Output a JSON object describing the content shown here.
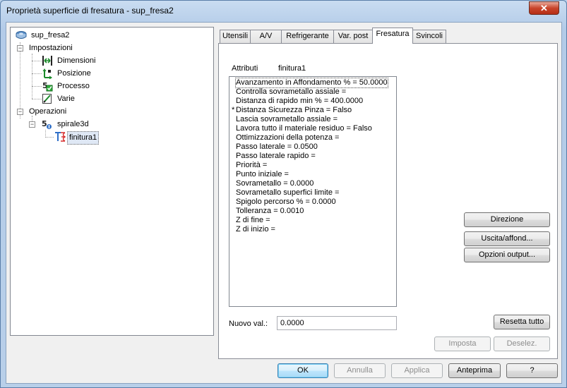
{
  "window": {
    "title": "Proprietà superficie di fresatura - sup_fresa2",
    "close_glyph": "✕"
  },
  "tree": {
    "root": {
      "label": "sup_fresa2",
      "icon": "surface-icon"
    },
    "impostazioni": {
      "label": "Impostazioni"
    },
    "items": [
      {
        "label": "Dimensioni",
        "icon": "dimensions-icon"
      },
      {
        "label": "Posizione",
        "icon": "position-icon"
      },
      {
        "label": "Processo",
        "icon": "process-icon"
      },
      {
        "label": "Varie",
        "icon": "misc-icon"
      }
    ],
    "operazioni": {
      "label": "Operazioni"
    },
    "spirale": {
      "label": "spirale3d",
      "icon": "operation-icon"
    },
    "finitura": {
      "label": "finitura1",
      "icon": "finishing-icon"
    }
  },
  "tabs": [
    {
      "label": "Utensili"
    },
    {
      "label": "A/V"
    },
    {
      "label": "Refrigerante"
    },
    {
      "label": "Var. post"
    },
    {
      "label": "Fresatura",
      "active": true
    },
    {
      "label": "Svincoli"
    }
  ],
  "attributes": {
    "label": "Attributi",
    "value": "finitura1"
  },
  "list": [
    {
      "mark": "",
      "text": "Avanzamento in Affondamento % = 50.0000"
    },
    {
      "mark": "",
      "text": "Controlla sovrametallo assiale ="
    },
    {
      "mark": "",
      "text": "Distanza di rapido min % = 400.0000"
    },
    {
      "mark": "*",
      "text": "Distanza Sicurezza Pinza = Falso"
    },
    {
      "mark": "",
      "text": "Lascia sovrametallo assiale ="
    },
    {
      "mark": "",
      "text": "Lavora tutto il materiale residuo = Falso"
    },
    {
      "mark": "",
      "text": "Ottimizzazioni della potenza ="
    },
    {
      "mark": "",
      "text": "Passo laterale = 0.0500"
    },
    {
      "mark": "",
      "text": "Passo laterale rapido ="
    },
    {
      "mark": "",
      "text": "Priorità ="
    },
    {
      "mark": "",
      "text": "Punto iniziale ="
    },
    {
      "mark": "",
      "text": "Sovrametallo = 0.0000"
    },
    {
      "mark": "",
      "text": "Sovrametallo superfici limite ="
    },
    {
      "mark": "",
      "text": "Spigolo percorso % = 0.0000"
    },
    {
      "mark": "",
      "text": "Tolleranza = 0.0010"
    },
    {
      "mark": "",
      "text": "Z di fine ="
    },
    {
      "mark": "",
      "text": "Z di inizio ="
    }
  ],
  "new_value": {
    "label": "Nuovo val.:",
    "value": "0.0000"
  },
  "side_buttons": {
    "direzione": "Direzione",
    "uscita": "Uscita/affond...",
    "opzioni": "Opzioni output...",
    "resetta": "Resetta tutto",
    "imposta": "Imposta",
    "deselez": "Deselez."
  },
  "footer": {
    "ok": "OK",
    "annulla": "Annulla",
    "applica": "Applica",
    "anteprima": "Anteprima",
    "help": "?"
  },
  "colors": {
    "accent": "#3c7fb1",
    "close": "#c9452b",
    "selection": "#dfe8f5"
  }
}
